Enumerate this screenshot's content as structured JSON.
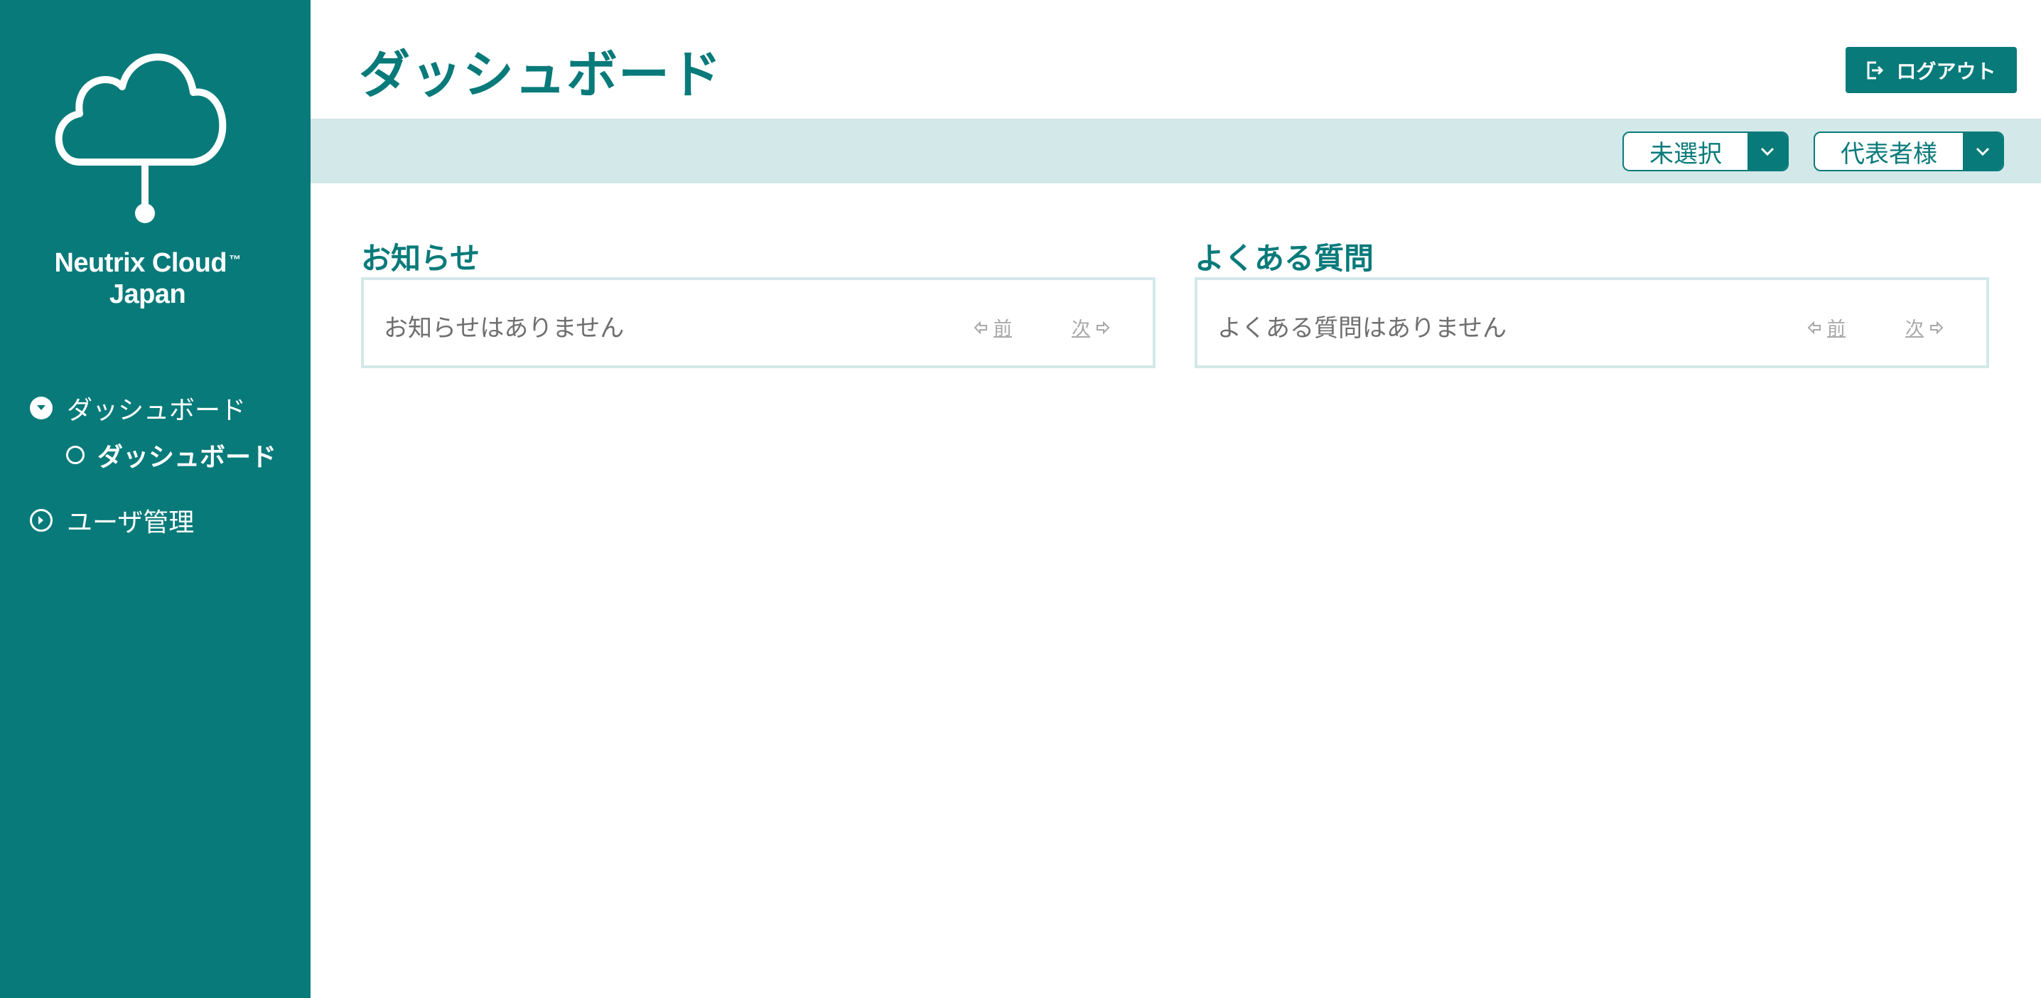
{
  "app": {
    "brand_line1": "Neutrix Cloud",
    "brand_tm": "™",
    "brand_line2": "Japan"
  },
  "sidebar": {
    "items": [
      {
        "label": "ダッシュボード",
        "icon": "chevron-down-circle-icon",
        "expanded": true
      },
      {
        "label": "ダッシュボード",
        "icon": "circle-outline-icon",
        "active": true
      },
      {
        "label": "ユーザ管理",
        "icon": "chevron-right-circle-icon",
        "expanded": false
      }
    ]
  },
  "header": {
    "title": "ダッシュボード",
    "logout_label": "ログアウト"
  },
  "filters": {
    "select1_value": "未選択",
    "select2_value": "代表者様"
  },
  "news": {
    "title": "お知らせ",
    "empty_text": "お知らせはありません",
    "prev_label": "前",
    "next_label": "次"
  },
  "faq": {
    "title": "よくある質問",
    "empty_text": "よくある質問はありません",
    "prev_label": "前",
    "next_label": "次"
  },
  "colors": {
    "brand": "#097a7a",
    "bar_bg": "#d3e8e8",
    "muted_text": "#6f6f6f",
    "pager_text": "#a8a8a8"
  }
}
